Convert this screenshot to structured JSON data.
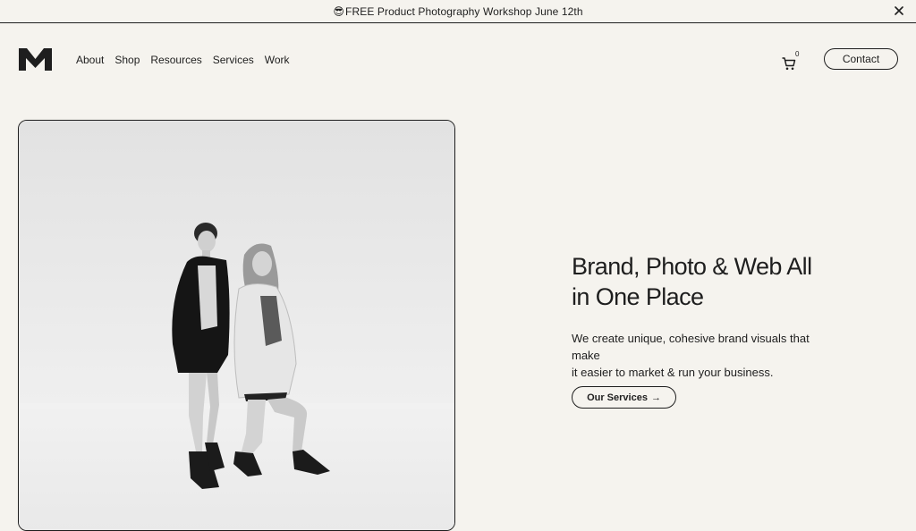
{
  "announcement": {
    "emoji": "😎",
    "text": "FREE Product Photography Workshop June 12th",
    "close_icon": "close-icon"
  },
  "header": {
    "logo": "M",
    "nav": [
      "About",
      "Shop",
      "Resources",
      "Services",
      "Work"
    ],
    "cart_icon": "cart-icon",
    "cart_count": "0",
    "contact_label": "Contact"
  },
  "hero": {
    "headline_line1": "Brand, Photo & Web All",
    "headline_line2": "in One Place",
    "subtext_line1": "We create unique, cohesive brand visuals that make",
    "subtext_line2": "it easier to market & run your business.",
    "cta_label": "Our Services",
    "cta_arrow": "→"
  }
}
